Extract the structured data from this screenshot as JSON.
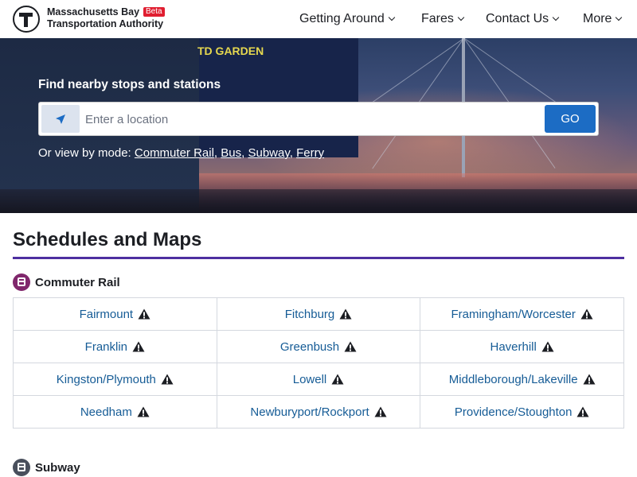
{
  "brand": {
    "line1": "Massachusetts Bay",
    "line2": "Transportation Authority",
    "badge": "Beta"
  },
  "nav": {
    "items": [
      {
        "label": "Getting Around"
      },
      {
        "label": "Fares"
      },
      {
        "label": "Contact Us"
      },
      {
        "label": "More"
      }
    ]
  },
  "hero": {
    "title": "Find nearby stops and stations",
    "arena_sign": "TD GARDEN",
    "search": {
      "placeholder": "Enter a location",
      "value": "",
      "go_label": "GO"
    },
    "mode_prefix": "Or view by mode:",
    "modes": [
      "Commuter Rail",
      "Bus",
      "Subway",
      "Ferry"
    ]
  },
  "main": {
    "section_title": "Schedules and Maps",
    "commuter_rail": {
      "heading": "Commuter Rail",
      "color": "#80276c",
      "lines": [
        "Fairmount",
        "Fitchburg",
        "Framingham/Worcester",
        "Franklin",
        "Greenbush",
        "Haverhill",
        "Kingston/Plymouth",
        "Lowell",
        "Middleborough/Lakeville",
        "Needham",
        "Newburyport/Rockport",
        "Providence/Stoughton"
      ]
    },
    "subway": {
      "heading": "Subway",
      "color": "#494f5c"
    }
  },
  "colors": {
    "link": "#165c96",
    "accent_rule": "#4d2fa0",
    "go_button": "#1c6cc4"
  }
}
